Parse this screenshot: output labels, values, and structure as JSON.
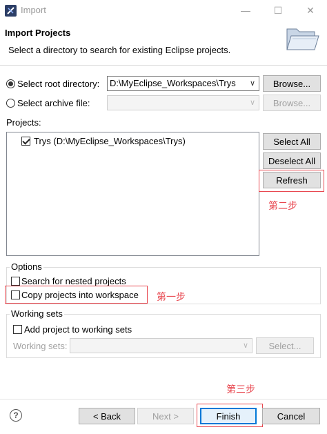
{
  "window": {
    "title": "Import",
    "minimize": "—",
    "maximize": "☐",
    "close": "✕"
  },
  "header": {
    "title": "Import Projects",
    "description": "Select a directory to search for existing Eclipse projects."
  },
  "source": {
    "root_label": "Select root directory:",
    "root_value": "D:\\MyEclipse_Workspaces\\Trys",
    "root_selected": true,
    "archive_label": "Select archive file:",
    "archive_value": "",
    "browse_label": "Browse..."
  },
  "projects": {
    "label": "Projects:",
    "items": [
      {
        "label": "Trys (D:\\MyEclipse_Workspaces\\Trys)",
        "checked": true
      }
    ],
    "select_all": "Select All",
    "deselect_all": "Deselect All",
    "refresh": "Refresh"
  },
  "options": {
    "label": "Options",
    "search_nested": "Search for nested projects",
    "copy_into_workspace": "Copy projects into workspace"
  },
  "working_sets": {
    "label": "Working sets",
    "add_to_sets": "Add project to working sets",
    "sets_label": "Working sets:",
    "select_button": "Select..."
  },
  "annotations": {
    "step1": "第一步",
    "step2": "第二步",
    "step3": "第三步",
    "color": "#e8474f"
  },
  "footer": {
    "help": "?",
    "back": "< Back",
    "next": "Next >",
    "finish": "Finish",
    "cancel": "Cancel"
  }
}
